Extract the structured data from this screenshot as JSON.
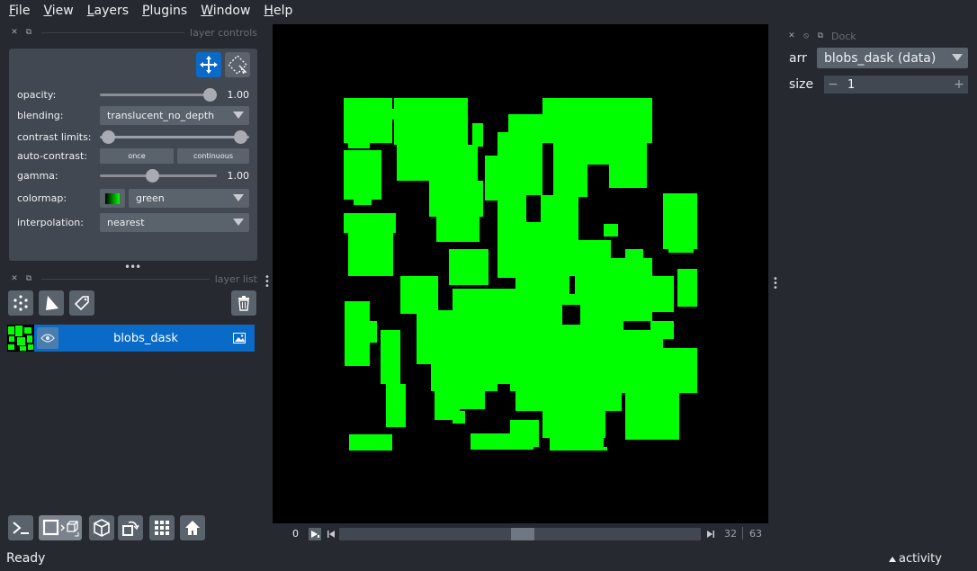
{
  "menu": [
    {
      "key": "F",
      "rest": "ile"
    },
    {
      "key": "V",
      "rest": "iew"
    },
    {
      "key": "L",
      "rest": "ayers"
    },
    {
      "key": "P",
      "rest": "lugins"
    },
    {
      "key": "W",
      "rest": "indow"
    },
    {
      "key": "H",
      "rest": "elp"
    }
  ],
  "layer_controls": {
    "title": "layer controls",
    "opacity_label": "opacity:",
    "opacity_value": "1.00",
    "blending_label": "blending:",
    "blending_value": "translucent_no_depth",
    "contrast_label": "contrast limits:",
    "contrast_limits": [
      0.0,
      1.0
    ],
    "autocontrast_label": "auto-contrast:",
    "once_label": "once",
    "continuous_label": "continuous",
    "gamma_label": "gamma:",
    "gamma_value": "1.00",
    "colormap_label": "colormap:",
    "colormap_value": "green",
    "interpolation_label": "interpolation:",
    "interpolation_value": "nearest"
  },
  "layer_list": {
    "title": "layer list",
    "layers": [
      {
        "name": "blobs_dask",
        "visible": true,
        "type": "image"
      }
    ]
  },
  "dims": {
    "start": "0",
    "current": "32",
    "max": "63",
    "position": 0.508
  },
  "right_dock": {
    "title": "Dock",
    "arr_label": "arr",
    "arr_value": "blobs_dask (data)",
    "size_label": "size",
    "size_value": "1",
    "minus": "−",
    "plus": "+"
  },
  "status": {
    "text": "Ready",
    "activity": "activity"
  },
  "colors": {
    "background": "#262930",
    "panel": "#414851",
    "accent": "#0a6ac7",
    "blob": "#00ff00"
  }
}
